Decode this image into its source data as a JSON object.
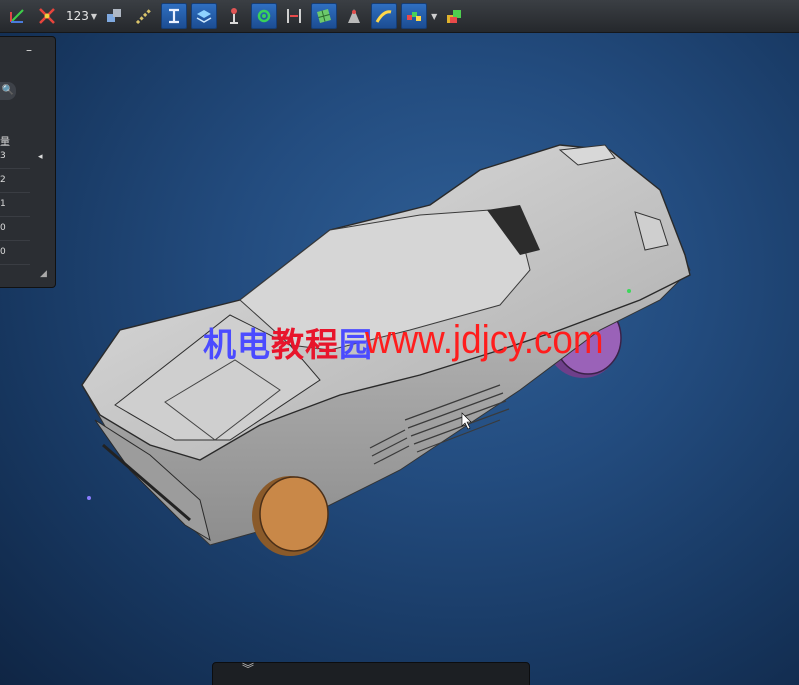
{
  "toolbar": {
    "counter_label": "123",
    "icons": [
      "axis-triad-icon",
      "snap-cross-icon",
      "numbering-icon",
      "assembly-icon",
      "constraint-chain-icon",
      "i-beam-icon",
      "layers-icon",
      "pin-tool-icon",
      "node-select-icon",
      "dimension-icon",
      "surface-grid-icon",
      "cone-tool-icon",
      "sweep-icon",
      "color-swatch-icon",
      "cube-stack-icon"
    ]
  },
  "panel": {
    "minimize_label": "–",
    "search_icon": "🔍",
    "header": "量",
    "rows": [
      "3",
      "2",
      "1",
      "0",
      "0"
    ],
    "collapse_icon": "◂",
    "grip_icon": "◢"
  },
  "bottom": {
    "expand_icon": "︾"
  },
  "watermark": {
    "cn_part1": "机电",
    "cn_part2": "教程",
    "cn_part3": "园",
    "url": "www.jdjcy.com"
  },
  "colors": {
    "viewport_bg": "#234c7f",
    "car_body": "#c9c9c9",
    "front_wheel": "#c98848",
    "rear_wheel": "#9a62b8",
    "watermark_blue": "#4b4bff",
    "watermark_red": "#ff1d1d"
  }
}
